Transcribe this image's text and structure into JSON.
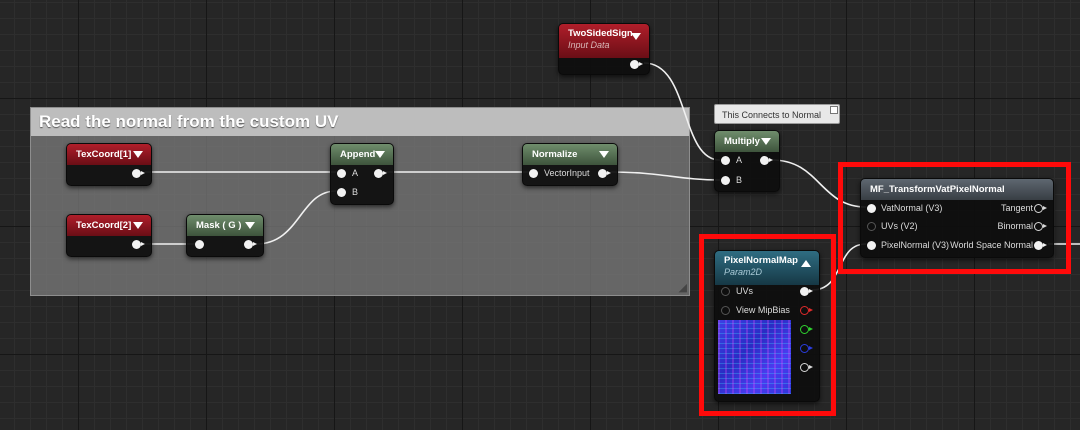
{
  "comment_box": {
    "title": "Read the normal from the custom UV"
  },
  "tooltip": {
    "text": "This Connects to Normal"
  },
  "nodes": {
    "texcoord1": {
      "title": "TexCoord[1]"
    },
    "texcoord2": {
      "title": "TexCoord[2]"
    },
    "mask": {
      "title": "Mask ( G )"
    },
    "append": {
      "title": "Append",
      "inputs": [
        "A",
        "B"
      ]
    },
    "normalize": {
      "title": "Normalize",
      "inputs": [
        "VectorInput"
      ]
    },
    "two_sided_sign": {
      "title": "TwoSidedSign",
      "subtitle": "Input Data"
    },
    "multiply": {
      "title": "Multiply",
      "inputs": [
        "A",
        "B"
      ]
    },
    "transform_vat": {
      "title": "MF_TransformVatPixelNormal",
      "inputs": [
        "VatNormal (V3)",
        "UVs (V2)",
        "PixelNormal (V3)"
      ],
      "outputs": [
        "Tangent",
        "Binormal",
        "World Space Normal"
      ]
    },
    "pixel_normal_map": {
      "title": "PixelNormalMap",
      "subtitle": "Param2D",
      "inputs": [
        "UVs",
        "View MipBias"
      ]
    }
  },
  "colors": {
    "highlight": "#ff0a0a",
    "header_red": "#8a1520",
    "header_green": "#52704f",
    "header_blue": "#224f60",
    "header_grey": "#4a525a",
    "wire": "#f0f0f0"
  },
  "icons": [
    "dropdown-triangle-icon",
    "collapse-triangle-icon",
    "resize-grip-icon"
  ]
}
